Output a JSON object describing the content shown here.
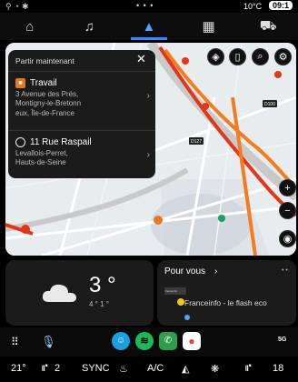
{
  "status": {
    "temp": "10°C",
    "time": "09:1"
  },
  "nav": {
    "tabs": [
      {
        "name": "home",
        "icon": "⌂"
      },
      {
        "name": "music",
        "icon": "♫"
      },
      {
        "name": "navigation",
        "icon": "▲"
      },
      {
        "name": "apps",
        "icon": "▦"
      },
      {
        "name": "vehicle",
        "icon": "⛟"
      }
    ]
  },
  "map": {
    "labels": {
      "d127": "D127",
      "d100": "D100"
    }
  },
  "card": {
    "header": "Partir maintenant",
    "dest1": {
      "title": "Travail",
      "line1": "3 Avenue des Prés,",
      "line2": "Montigny-le-Bretonn",
      "line3": "eux, Île-de-France"
    },
    "dest2": {
      "title": "11 Rue Raspail",
      "line1": "Levallois-Perret,",
      "line2": "Hauts-de-Seine"
    }
  },
  "weather": {
    "temp": "3 °",
    "minmax": "4 ° 1 °"
  },
  "foryou": {
    "title": "Pour vous",
    "source_badge": "franceinfo",
    "item": "Franceinfo - le flash eco"
  },
  "climate": {
    "left_temp": "21°",
    "seat": "2",
    "sync": "SYNC",
    "ac": "A/C",
    "right_temp": "18"
  },
  "dock": {
    "signal": "5G"
  }
}
